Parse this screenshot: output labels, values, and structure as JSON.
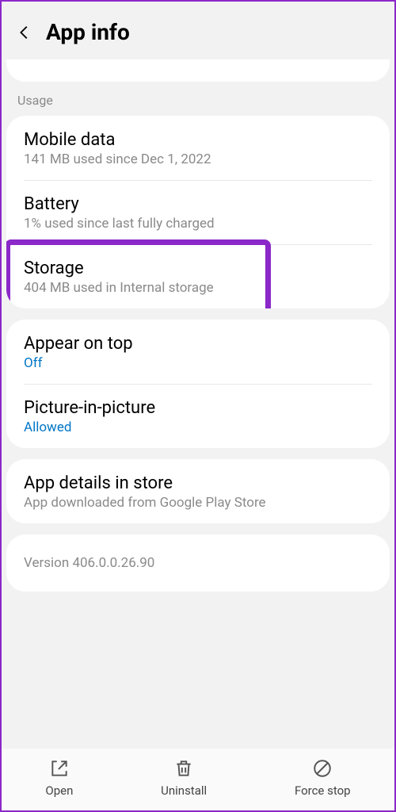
{
  "header": {
    "title": "App info"
  },
  "usage": {
    "label": "Usage",
    "mobile_data": {
      "title": "Mobile data",
      "subtitle": "141 MB used since Dec 1, 2022"
    },
    "battery": {
      "title": "Battery",
      "subtitle": "1% used since last fully charged"
    },
    "storage": {
      "title": "Storage",
      "subtitle": "404 MB used in Internal storage"
    }
  },
  "display": {
    "appear_on_top": {
      "title": "Appear on top",
      "state": "Off"
    },
    "pip": {
      "title": "Picture-in-picture",
      "state": "Allowed"
    }
  },
  "store": {
    "title": "App details in store",
    "subtitle": "App downloaded from Google Play Store"
  },
  "version": {
    "text": "Version 406.0.0.26.90"
  },
  "bottom": {
    "open": "Open",
    "uninstall": "Uninstall",
    "force_stop": "Force stop"
  }
}
